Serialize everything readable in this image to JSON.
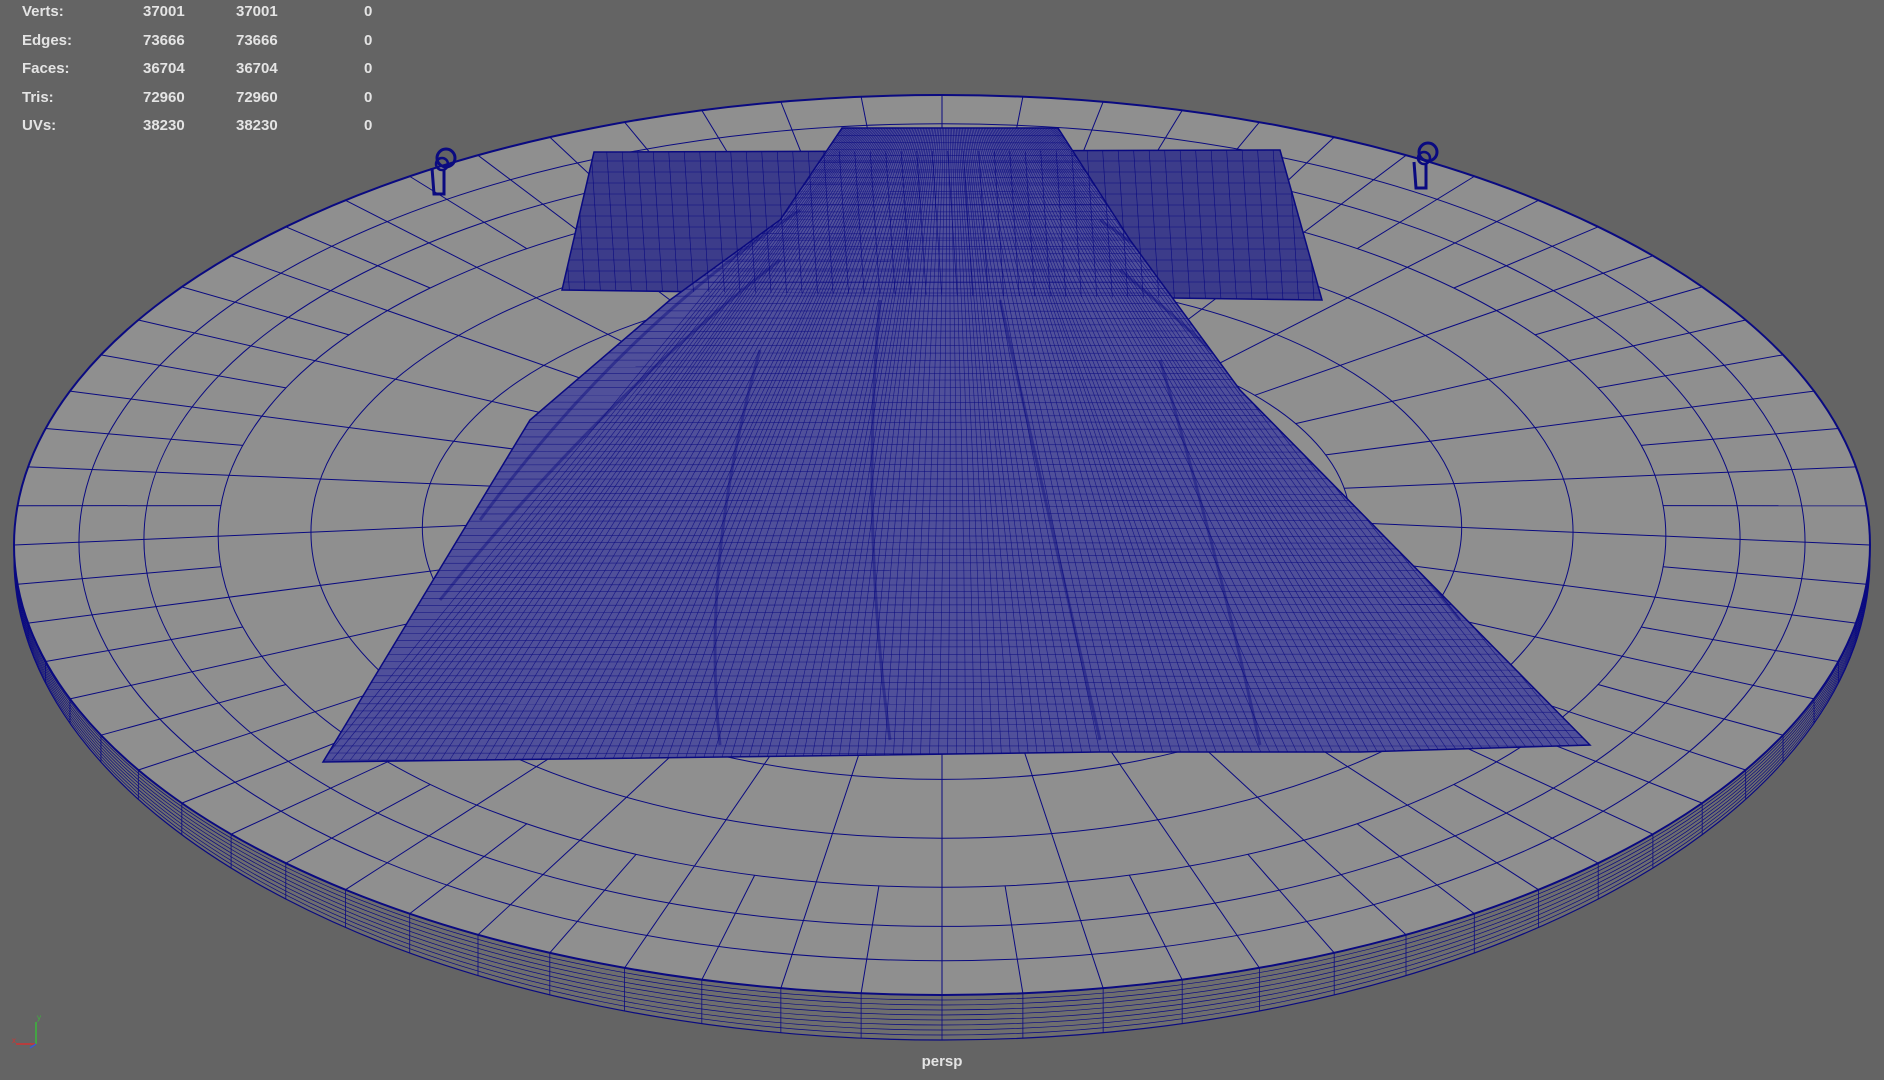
{
  "viewport": {
    "background": "#646464",
    "wire_color": "#0a0a80",
    "hud_text_color": "#e4e4e4",
    "camera": "persp"
  },
  "hud": {
    "rows": [
      {
        "label": "Verts:",
        "c1": "37001",
        "c2": "37001",
        "c3": "0"
      },
      {
        "label": "Edges:",
        "c1": "73666",
        "c2": "73666",
        "c3": "0"
      },
      {
        "label": "Faces:",
        "c1": "36704",
        "c2": "36704",
        "c3": "0"
      },
      {
        "label": "Tris:",
        "c1": "72960",
        "c2": "72960",
        "c3": "0"
      },
      {
        "label": "UVs:",
        "c1": "38230",
        "c2": "38230",
        "c3": "0"
      }
    ]
  },
  "axis_gizmo": {
    "y_label": "y",
    "x_label": "x",
    "icon": "axis-gizmo-icon"
  },
  "scene": {
    "objects": [
      "stage-disc-mesh",
      "cloth-drape-mesh",
      "spotlight-left-icon",
      "spotlight-right-icon"
    ]
  }
}
